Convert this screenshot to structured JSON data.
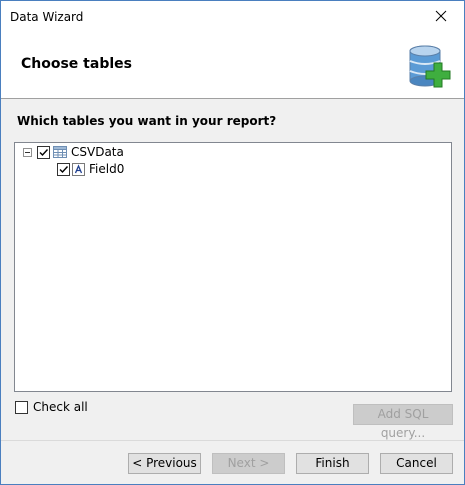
{
  "window": {
    "title": "Data Wizard"
  },
  "header": {
    "title": "Choose tables"
  },
  "question": "Which tables you want in your report?",
  "tree": {
    "root": {
      "label": "CSVData",
      "checked": true,
      "expanded": true
    },
    "children": [
      {
        "label": "Field0",
        "checked": true
      }
    ]
  },
  "check_all": {
    "label": "Check all",
    "checked": false
  },
  "buttons": {
    "add_sql": "Add SQL query...",
    "previous": "< Previous",
    "next": "Next >",
    "finish": "Finish",
    "cancel": "Cancel"
  },
  "colors": {
    "window_border": "#4a7fbf",
    "dialog_bg": "#f0f0f0",
    "db_icon_blue": "#5b9bd5",
    "plus_green": "#3fae3f"
  }
}
